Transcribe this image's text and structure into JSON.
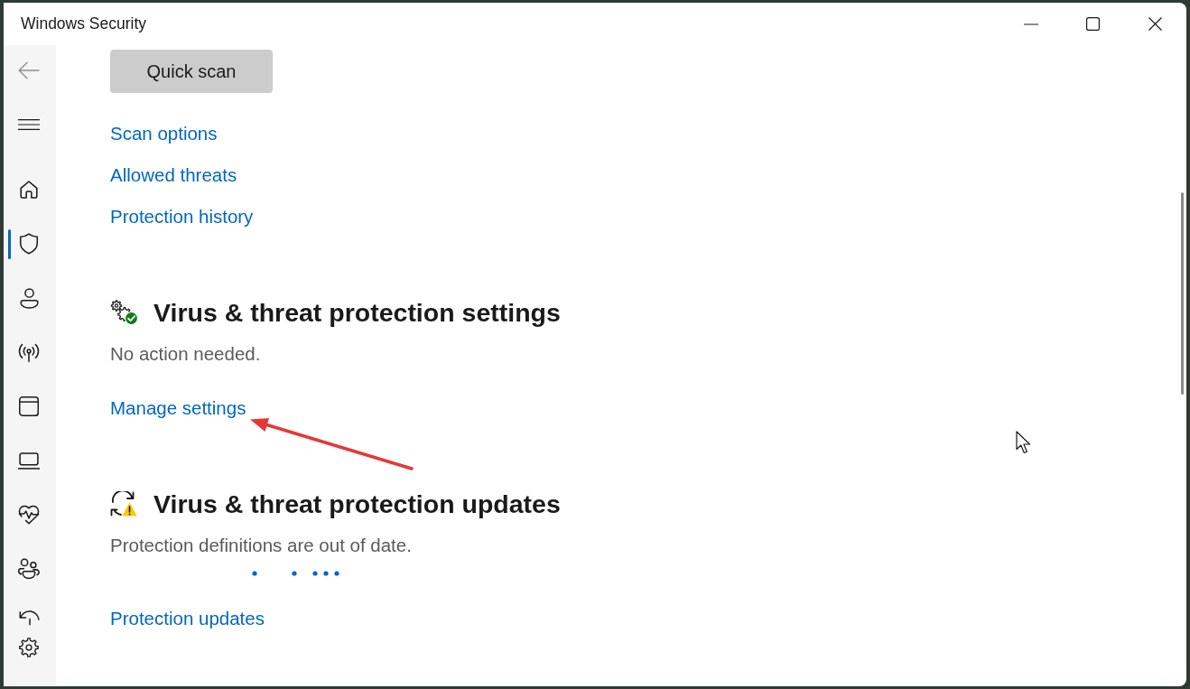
{
  "window": {
    "title": "Windows Security"
  },
  "sidebar": {
    "back": {
      "disabled": true
    },
    "items": [
      {
        "kind": "home",
        "selected": false
      },
      {
        "kind": "shield",
        "selected": true
      },
      {
        "kind": "account",
        "selected": false
      },
      {
        "kind": "network",
        "selected": false
      },
      {
        "kind": "app",
        "selected": false
      },
      {
        "kind": "device",
        "selected": false
      },
      {
        "kind": "health",
        "selected": false
      },
      {
        "kind": "family",
        "selected": false
      },
      {
        "kind": "history",
        "selected": false
      }
    ]
  },
  "scan": {
    "button": "Quick scan",
    "links": [
      "Scan options",
      "Allowed threats",
      "Protection history"
    ]
  },
  "sections": [
    {
      "kind": "settings",
      "title": "Virus & threat protection settings",
      "status": "No action needed.",
      "busy": false,
      "link": "Manage settings"
    },
    {
      "kind": "updates",
      "title": "Virus & threat protection updates",
      "status": "Protection definitions are out of date.",
      "busy": true,
      "link": "Protection updates"
    }
  ]
}
